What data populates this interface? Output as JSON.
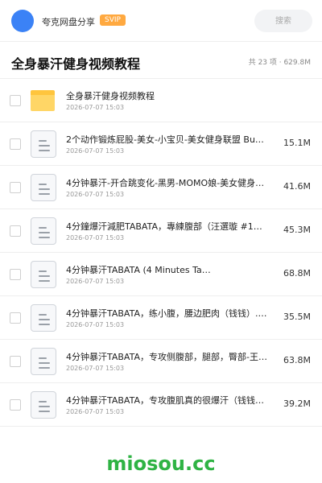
{
  "header": {
    "user_name": "夸克网盘分享",
    "badge": "SVIP",
    "search_placeholder": "搜索"
  },
  "folder": {
    "title": "全身暴汗健身视频教程",
    "meta": "共 23 项 · 629.8M"
  },
  "files": [
    {
      "name": "全身暴汗健身视频教程",
      "date": "2026-07-07 15:03",
      "size": "",
      "type": "folder"
    },
    {
      "name": "2个动作锻炼屁股-美女-小宝贝-美女健身联盟 Bu…",
      "date": "2026-07-07 15:03",
      "size": "15.1M",
      "type": "file"
    },
    {
      "name": "4分钟暴汗-开合跳变化-黑男-MOMO娘-美女健身…",
      "date": "2026-07-07 15:03",
      "size": "41.6M",
      "type": "file"
    },
    {
      "name": "4分鐘爆汗減肥TABATA，專練腹部（汪選璇 #1…",
      "date": "2026-07-07 15:03",
      "size": "45.3M",
      "type": "file"
    },
    {
      "name": "4分钟暴汗TABATA (4 Minutes Ta…",
      "date": "2026-07-07 15:03",
      "size": "68.8M",
      "type": "file"
    },
    {
      "name": "4分钟暴汗TABATA，练小腹，腰边肥肉（钱钱）.…",
      "date": "2026-07-07 15:03",
      "size": "35.5M",
      "type": "file"
    },
    {
      "name": "4分钟暴汗TABATA，专攻侧腹部，腿部，臀部-王…",
      "date": "2026-07-07 15:03",
      "size": "63.8M",
      "type": "file"
    },
    {
      "name": "4分钟暴汗TABATA，专攻腹肌真的很爆汗（钱钱）…",
      "date": "2026-07-07 15:03",
      "size": "39.2M",
      "type": "file"
    }
  ],
  "watermark": "miosou.cc",
  "colors": {
    "avatar": "#3b82f6",
    "badge": "#ffa940",
    "folder": "#ffd666",
    "watermark": "#2fb344"
  }
}
